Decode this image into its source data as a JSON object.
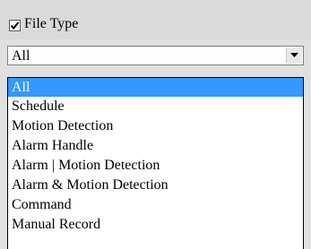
{
  "filter": {
    "checkbox_label": "File Type",
    "checked": true
  },
  "select": {
    "value": "All"
  },
  "dropdown": {
    "options": [
      "All",
      "Schedule",
      "Motion Detection",
      "Alarm Handle",
      "Alarm | Motion Detection",
      "Alarm & Motion Detection",
      "Command",
      "Manual Record"
    ],
    "selected_index": 0
  },
  "colors": {
    "highlight": "#3399ff",
    "panel_bg": "#dadada"
  },
  "icons": {
    "check": "check-icon",
    "dropdown_arrow": "chevron-down-icon"
  }
}
